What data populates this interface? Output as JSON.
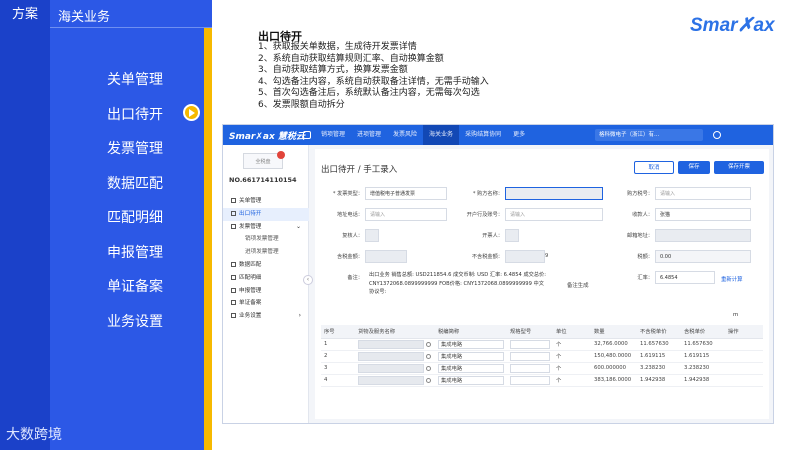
{
  "slide": {
    "tab_left": "方案",
    "tab_right": "海关业务",
    "menu": [
      "关单管理",
      "出口待开",
      "发票管理",
      "数据匹配",
      "匹配明细",
      "申报管理",
      "单证备案",
      "业务设置"
    ],
    "brand_footer": "大数跨境",
    "logo": "Smar✗ax",
    "accent_blue": "#2c58e6",
    "accent_yellow": "#f6b900"
  },
  "description": {
    "title": "出口待开",
    "items": [
      "1、获取报关单数据，生成待开发票详情",
      "2、系统自动获取结算规则汇率、自动换算金额",
      "3、自动获取结算方式，换算发票金额",
      "4、勾选备注内容，系统自动获取备注详情，无需手动输入",
      "5、首次勾选备注后，系统默认备注内容，无需每次勾选",
      "6、发票限额自动拆分"
    ]
  },
  "app": {
    "logo": "Smar✗ax 慧税云",
    "nav": [
      "销项管理",
      "进项管理",
      "发票风险",
      "海关业务",
      "采购结算协同",
      "更多"
    ],
    "active_nav": "海关业务",
    "org": "格科微电子（浙江）有...",
    "side": {
      "badge": "全税盘",
      "number": "NO.661714110154",
      "items": [
        {
          "label": "关单管理",
          "type": "item"
        },
        {
          "label": "出口待开",
          "type": "active"
        },
        {
          "label": "发票管理",
          "type": "item",
          "arrow": "⌄"
        },
        {
          "label": "销项发票管理",
          "type": "sub"
        },
        {
          "label": "进项发票管理",
          "type": "sub"
        },
        {
          "label": "数据匹配",
          "type": "item"
        },
        {
          "label": "匹配明细",
          "type": "item"
        },
        {
          "label": "申报管理",
          "type": "item"
        },
        {
          "label": "单证备案",
          "type": "item"
        },
        {
          "label": "业务设置",
          "type": "item",
          "arrow": "›"
        }
      ]
    },
    "page_title": "出口待开 / 手工录入",
    "buttons": {
      "cancel": "取消",
      "save": "保存",
      "save_open": "保存开票"
    },
    "form": {
      "invoice_type_label": "* 发票类型：",
      "invoice_type_value": "增值税电子普通发票",
      "buyer_name_label": "* 购方名称：",
      "buyer_tax_label": "购方税号：",
      "buyer_tax_ph": "请输入",
      "address_label": "地址电话：",
      "address_ph": "请输入",
      "bank_label": "开户行及账号：",
      "bank_ph": "请输入",
      "payee_label": "收款人：",
      "payee_value": "张猫",
      "reviewer_label": "复核人：",
      "drawer_label": "开票人：",
      "email_label": "邮箱地址：",
      "email_suffix": "m",
      "tax_incl_label": "含税金额：",
      "tax_excl_label": "不含税金额：",
      "tax_excl_suffix": "9",
      "tax_amount_label": "税额：",
      "tax_amount_value": "0.00",
      "note_label": "备注：",
      "note_text": "出口业务 销售总额: USD211854.6 成交币制: USD 汇率: 6.4854 成交总价: CNY1372068.0899999999 FOB价格: CNY1372068.0899999999 中文协议号:",
      "note_gen": "备注生成",
      "rate_label": "汇率：",
      "rate_value": "6.4854",
      "recalc": "重新计算"
    },
    "table": {
      "headers": [
        "序号",
        "货物及服务名称",
        "税编简称",
        "规格型号",
        "单位",
        "数量",
        "不含税单价",
        "含税单价",
        "操作"
      ],
      "rows": [
        {
          "no": "1",
          "short": "集成电路",
          "unit": "个",
          "qty": "32,766.0000",
          "price_ex": "11.657630",
          "price_in": "11.657630"
        },
        {
          "no": "2",
          "short": "集成电路",
          "unit": "个",
          "qty": "150,480.0000",
          "price_ex": "1.619115",
          "price_in": "1.619115"
        },
        {
          "no": "3",
          "short": "集成电路",
          "unit": "个",
          "qty": "600.000000",
          "price_ex": "3.238230",
          "price_in": "3.238230"
        },
        {
          "no": "4",
          "short": "集成电路",
          "unit": "个",
          "qty": "383,186.0000",
          "price_ex": "1.942938",
          "price_in": "1.942938"
        }
      ]
    }
  }
}
